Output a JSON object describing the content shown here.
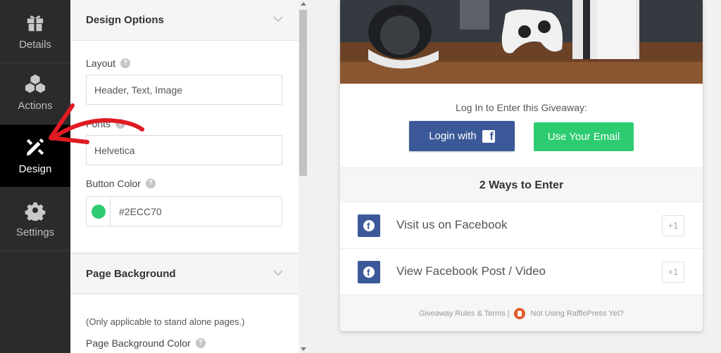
{
  "nav": {
    "items": [
      {
        "label": "Details",
        "icon": "gift-icon"
      },
      {
        "label": "Actions",
        "icon": "cubes-icon"
      },
      {
        "label": "Design",
        "icon": "pencil-ruler-icon",
        "active": true
      },
      {
        "label": "Settings",
        "icon": "gear-icon"
      }
    ]
  },
  "design_options": {
    "title": "Design Options",
    "layout_label": "Layout",
    "layout_value": "Header, Text, Image",
    "fonts_label": "Fonts",
    "fonts_value": "Helvetica",
    "button_color_label": "Button Color",
    "button_color_value": "#2ECC70"
  },
  "page_background": {
    "title": "Page Background",
    "note": "(Only applicable to stand alone pages.)",
    "color_label": "Page Background Color"
  },
  "preview": {
    "login_title": "Log In to Enter this Giveaway:",
    "login_with_label": "Login with",
    "email_button_label": "Use Your Email",
    "ways_heading": "2 Ways to Enter",
    "entries": [
      {
        "label": "Visit us on Facebook",
        "points": "+1"
      },
      {
        "label": "View Facebook Post / Video",
        "points": "+1"
      }
    ],
    "footer_rules": "Giveaway Rules & Terms |",
    "footer_cta": "Not Using RafflePress Yet?"
  },
  "colors": {
    "button_green": "#2ecc70",
    "facebook_blue": "#3b5998",
    "annotation_red": "#e01b24"
  }
}
